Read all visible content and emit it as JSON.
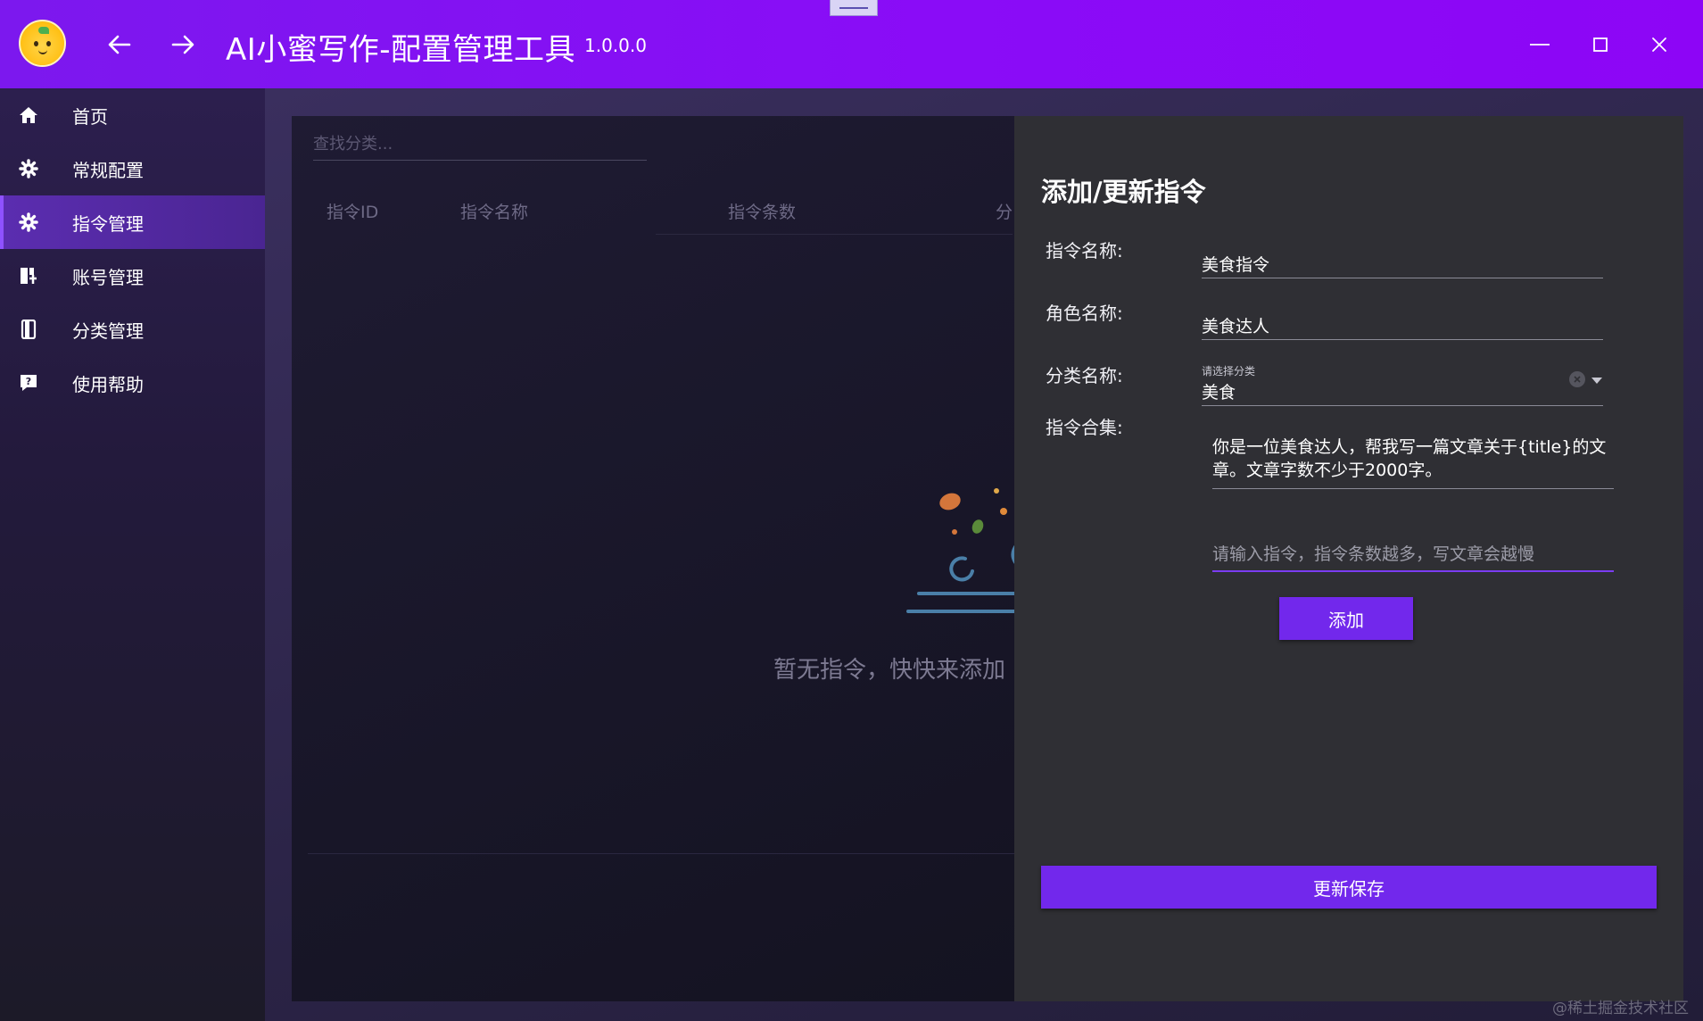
{
  "window": {
    "title": "AI小蜜写作-配置管理工具",
    "version": "1.0.0.0"
  },
  "icons": {
    "back": "arrow-left-icon",
    "forward": "arrow-right-icon",
    "minimize": "minimize-icon",
    "maximize": "maximize-icon",
    "close": "close-icon"
  },
  "sidebar": {
    "items": [
      {
        "label": "首页",
        "icon": "home-icon"
      },
      {
        "label": "常规配置",
        "icon": "gear-icon"
      },
      {
        "label": "指令管理",
        "icon": "gear-icon",
        "active": true
      },
      {
        "label": "账号管理",
        "icon": "account-icon"
      },
      {
        "label": "分类管理",
        "icon": "book-icon"
      },
      {
        "label": "使用帮助",
        "icon": "help-chat-icon"
      }
    ]
  },
  "list": {
    "search_placeholder": "查找分类...",
    "columns": [
      "指令ID",
      "指令名称",
      "指令条数",
      "分"
    ],
    "empty_text": "暂无指令，快快来添加"
  },
  "drawer": {
    "title": "添加/更新指令",
    "name_label": "指令名称:",
    "name_value": "美食指令",
    "role_label": "角色名称:",
    "role_value": "美食达人",
    "category_label": "分类名称:",
    "category_hint": "请选择分类",
    "category_value": "美食",
    "commands_label": "指令合集:",
    "command_text": "你是一位美食达人，帮我写一篇文章关于{title}的文章。文章字数不少于2000字。",
    "command_placeholder": "请输入指令，指令条数越多，写文章会越慢",
    "add_label": "添加",
    "save_label": "更新保存"
  },
  "watermark": "@稀土掘金技术社区",
  "colors": {
    "accent": "#7228ec",
    "titlebar": "#8a0cf7",
    "drawer_bg": "#2f2f34"
  }
}
